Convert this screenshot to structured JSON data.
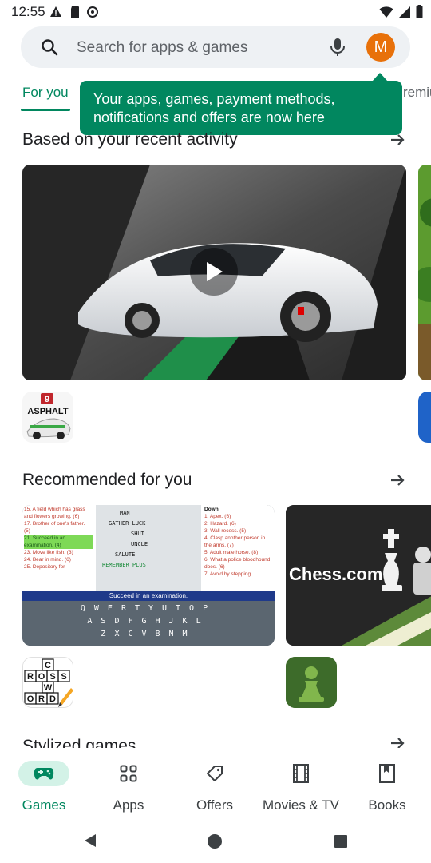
{
  "status_bar": {
    "time": "12:55"
  },
  "search": {
    "placeholder": "Search for apps & games"
  },
  "account": {
    "initial": "M",
    "color": "#e8710a"
  },
  "tabs": {
    "active": "For you",
    "partial_right": "remiu"
  },
  "tooltip": {
    "text": "Your apps, games, payment methods, notifications and offers are now here",
    "color": "#01875f"
  },
  "sections": {
    "recent": {
      "title": "Based on your recent activity"
    },
    "recommended": {
      "title": "Recommended for you"
    },
    "stylized": {
      "title": "Stylized games"
    }
  },
  "crossword_card": {
    "clues_left": [
      "15. A field which has grass and flowers growing. (6)",
      "17. Brother of one's father. (5)",
      "21. Succeed in an examination. (4)",
      "23. Move like fish. (3)",
      "24. Bear in mind. (6)",
      "25. Depository for"
    ],
    "clues_right_title": "Down",
    "clues_right": [
      "1. Apex. (6)",
      "2. Hazard. (6)",
      "3. Wall recess. (5)",
      "4. Clasp another person in the arms. (7)",
      "5. Adult male horse. (8)",
      "6. What a police bloodhound does. (6)",
      "7. Avoid by stepping"
    ],
    "grid_words": [
      "MAN",
      "GATHER LUCK",
      "SHUT",
      "UNCLE",
      "SALUTE",
      "REMEMBER PLUS"
    ],
    "clue_bar": "Succeed in an examination.",
    "keyboard_rows": [
      "QWERTYUIOP",
      "ASDFGHJKL",
      "ZXCVBNM"
    ]
  },
  "chess_card": {
    "brand": "Chess.com"
  },
  "app_icons": {
    "asphalt_badge": "9",
    "asphalt_wordmark": "ASPHALT",
    "crossword_letters": [
      "C",
      "R",
      "O",
      "S",
      "S",
      "W",
      "O",
      "R",
      "D"
    ]
  },
  "bottom_nav": {
    "items": [
      {
        "label": "Games",
        "icon": "gamepad-icon",
        "active": true
      },
      {
        "label": "Apps",
        "icon": "apps-grid-icon",
        "active": false
      },
      {
        "label": "Offers",
        "icon": "offer-tag-icon",
        "active": false
      },
      {
        "label": "Movies & TV",
        "icon": "movie-icon",
        "active": false
      },
      {
        "label": "Books",
        "icon": "bookmark-icon",
        "active": false
      }
    ],
    "active_pill_color": "#d3f2e7"
  }
}
